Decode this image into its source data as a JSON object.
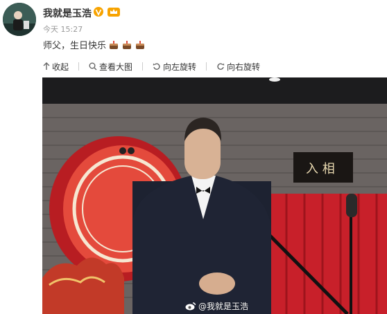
{
  "post": {
    "username": "我就是玉浩",
    "timestamp": "今天 15:27",
    "text": "师父，生日快乐",
    "emoji": [
      "cake-emoji",
      "cake-emoji",
      "cake-emoji"
    ]
  },
  "toolbar": {
    "collapse_label": "收起",
    "view_large_label": "查看大图",
    "rotate_left_label": "向左旋转",
    "rotate_right_label": "向右旋转"
  },
  "photo": {
    "watermark": "@我就是玉浩",
    "plaque_text": "入 相"
  },
  "colors": {
    "accent_orange": "#f7a300",
    "text": "#333333",
    "meta": "#999999",
    "curtain_red": "#c8202a"
  }
}
